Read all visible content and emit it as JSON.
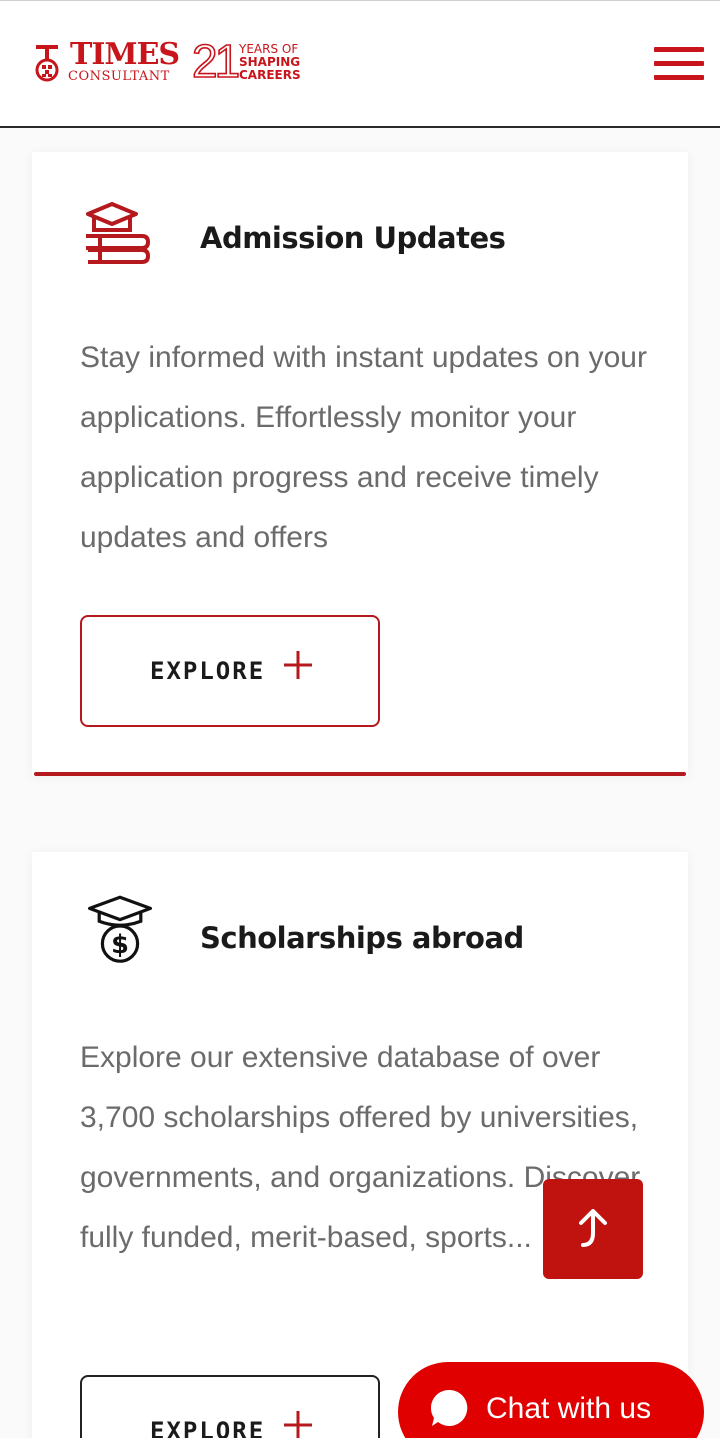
{
  "header": {
    "logo": {
      "brand": "TIMES",
      "sub": "CONSULTANT",
      "years_number": "21",
      "tagline": [
        "YEARS OF",
        "SHAPING",
        "CAREERS"
      ]
    },
    "menu_icon": "hamburger-menu-icon"
  },
  "cards": [
    {
      "icon": "graduation-books-icon",
      "title": "Admission Updates",
      "description": "Stay informed with instant updates on your applications. Effortlessly monitor your application progress and receive timely updates and offers",
      "button_label": "EXPLORE",
      "button_icon": "plus-icon"
    },
    {
      "icon": "scholarship-dollar-cap-icon",
      "title": "Scholarships abroad",
      "description": "Explore our extensive database of over 3,700 scholarships offered by universities, governments, and organizations. Discover fully funded, merit-based, sports...",
      "button_label": "EXPLORE",
      "button_icon": "plus-icon"
    }
  ],
  "floating": {
    "scroll_top_icon": "arrow-up-icon",
    "chat_label": "Chat with us",
    "chat_icon": "chat-bubble-icon"
  },
  "colors": {
    "brand_red": "#c8151b",
    "accent_red": "#b5191e",
    "chat_red": "#e00000",
    "text_dark": "#1a1a1a",
    "text_muted": "#6b6b6b"
  }
}
